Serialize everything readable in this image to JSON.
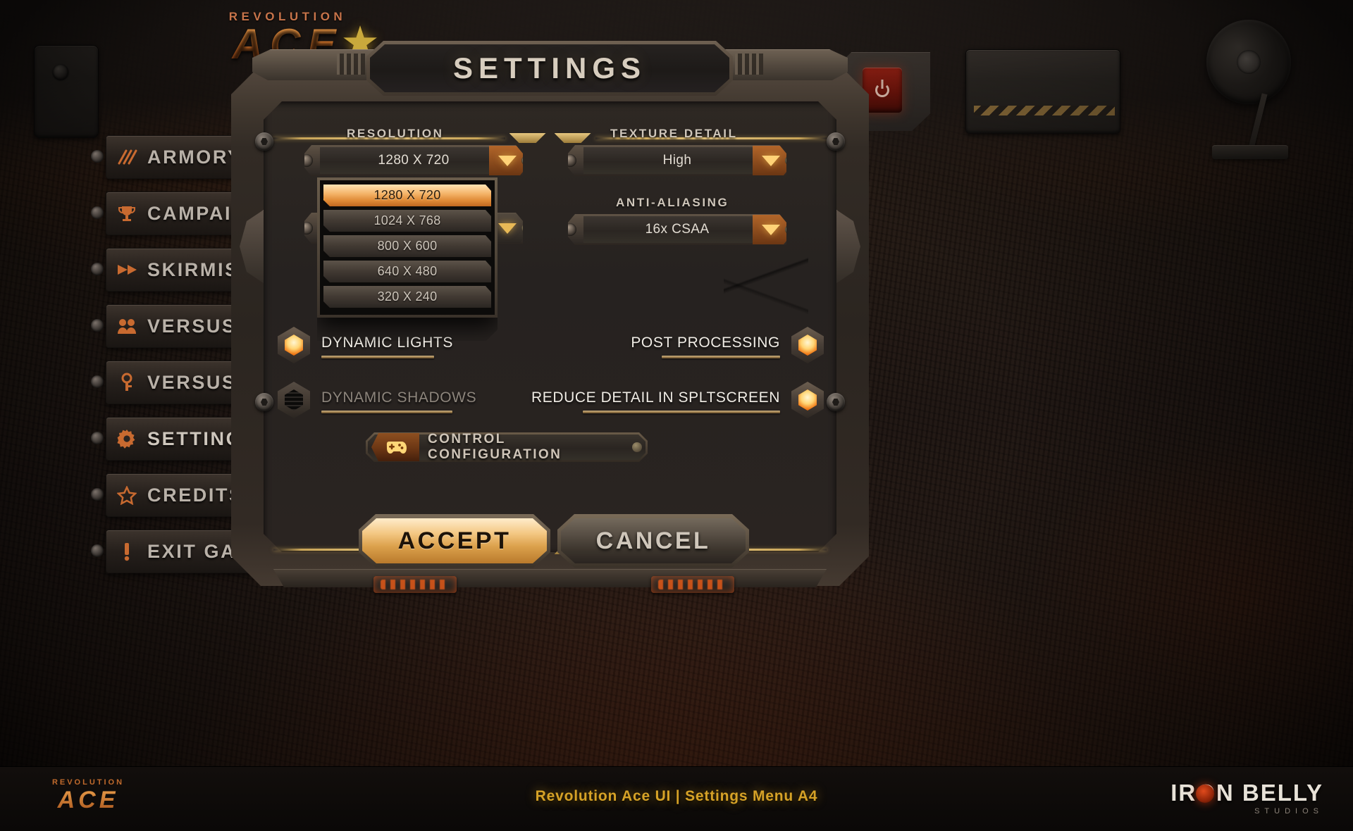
{
  "game": {
    "logo_top": "REVOLUTION",
    "logo_main": "ACE",
    "star_icon": "star-icon"
  },
  "main_menu": {
    "items": [
      {
        "label": "ARMORY",
        "icon": "slash-marks-icon"
      },
      {
        "label": "CAMPAIGN",
        "icon": "trophy-icon"
      },
      {
        "label": "SKIRMISH",
        "icon": "arrow-forward-icon"
      },
      {
        "label": "VERSUS",
        "icon": "two-people-icon"
      },
      {
        "label": "VERSUS",
        "icon": "key-icon"
      },
      {
        "label": "SETTINGS",
        "icon": "gear-icon"
      },
      {
        "label": "CREDITS",
        "icon": "star-outline-icon"
      },
      {
        "label": "EXIT GAME",
        "icon": "exclamation-icon"
      }
    ]
  },
  "hud": {
    "power_button": "power-icon"
  },
  "dialog": {
    "title": "SETTINGS",
    "resolution": {
      "label": "RESOLUTION",
      "value": "1280 X 720",
      "arrow_icon": "chevron-down-icon",
      "expanded": true,
      "options": [
        "1280 X 720",
        "1024 X 768",
        "800 X 600",
        "640 X 480",
        "320 X 240"
      ],
      "selected_index": 0
    },
    "texture_detail": {
      "label": "TEXTURE DETAIL",
      "value": "High",
      "arrow_icon": "chevron-down-icon"
    },
    "anti_aliasing": {
      "label": "ANTI-ALIASING",
      "value": "16x CSAA",
      "arrow_icon": "chevron-down-icon"
    },
    "hidden_select": {
      "arrow_icon": "chevron-down-icon"
    },
    "toggles": [
      {
        "label": "DYNAMIC LIGHTS",
        "state": "on",
        "enabled": true
      },
      {
        "label": "DYNAMIC SHADOWS",
        "state": "off",
        "enabled": false
      },
      {
        "label": "POST PROCESSING",
        "state": "on",
        "enabled": true
      },
      {
        "label": "REDUCE DETAIL IN SPLTSCREEN",
        "state": "on",
        "enabled": true
      }
    ],
    "control_config": {
      "label": "CONTROL CONFIGURATION",
      "icon": "gamepad-icon"
    },
    "accept_button": "ACCEPT",
    "cancel_button": "CANCEL"
  },
  "footer": {
    "caption": "Revolution Ace UI | Settings Menu A4",
    "logo_left_top": "REVOLUTION",
    "logo_left_main": "ACE",
    "studio_name": "IRON BELLY",
    "studio_sub": "STUDIOS"
  },
  "colors": {
    "accent_orange": "#e08c38",
    "accent_gold": "#d6a227",
    "text_light": "#cfc6ba",
    "panel_dark": "#2b2520"
  }
}
